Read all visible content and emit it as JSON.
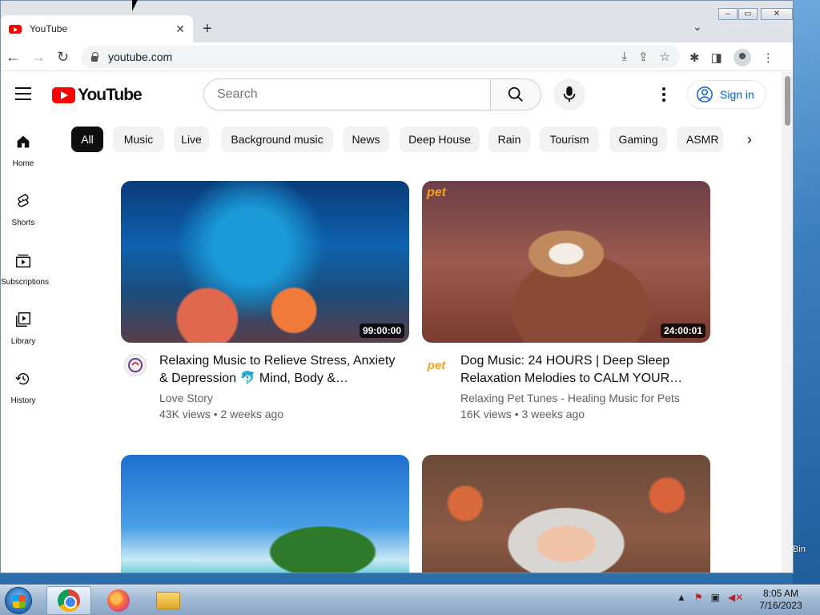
{
  "browser": {
    "tab_title": "YouTube",
    "url": "youtube.com",
    "new_tab": "+",
    "close": "✕"
  },
  "yt": {
    "logo_text": "YouTube",
    "search_placeholder": "Search",
    "sign_in": "Sign in",
    "guide": [
      {
        "label": "Home",
        "icon": "home-icon"
      },
      {
        "label": "Shorts",
        "icon": "shorts-icon"
      },
      {
        "label": "Subscriptions",
        "icon": "subscriptions-icon"
      },
      {
        "label": "Library",
        "icon": "library-icon"
      },
      {
        "label": "History",
        "icon": "history-icon"
      }
    ],
    "chips": [
      "All",
      "Music",
      "Live",
      "Background music",
      "News",
      "Deep House",
      "Rain",
      "Tourism",
      "Gaming",
      "ASMR"
    ],
    "videos": [
      {
        "title": "Relaxing Music to Relieve Stress, Anxiety & Depression 🐬 Mind, Body &…",
        "channel": "Love Story",
        "stats": "43K views • 2 weeks ago",
        "duration": "99:00:00"
      },
      {
        "title": "Dog Music: 24 HOURS | Deep Sleep Relaxation Melodies to CALM YOUR…",
        "channel": "Relaxing Pet Tunes - Healing Music for Pets",
        "stats": "16K views • 3 weeks ago",
        "duration": "24:00:01",
        "badge": "pet"
      },
      {
        "title": "",
        "channel": "",
        "stats": "",
        "duration": ""
      },
      {
        "title": "",
        "channel": "",
        "stats": "",
        "duration": ""
      }
    ]
  },
  "taskbar": {
    "time": "8:05 AM",
    "date": "7/16/2023"
  },
  "desktop": {
    "recycle_bin_label": "Bin"
  },
  "colors": {
    "brand": "#ff0000",
    "link": "#065fd4",
    "chip_active": "#0f0f0f"
  }
}
